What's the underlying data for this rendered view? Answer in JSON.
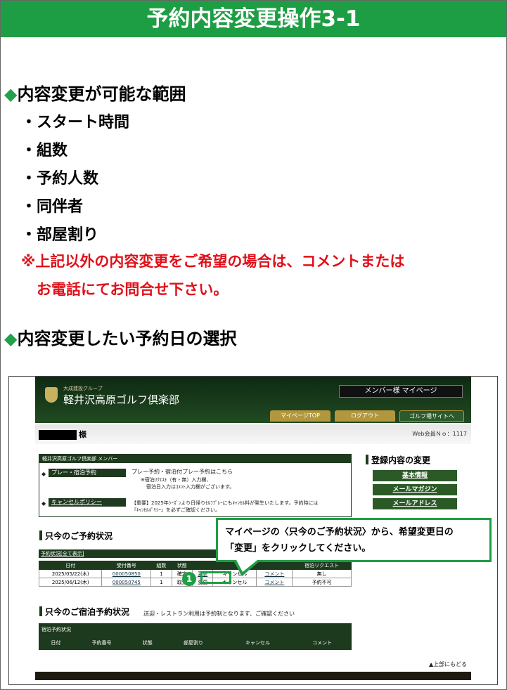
{
  "title": "予約内容変更操作3-1",
  "section1": {
    "heading": "内容変更が可能な範囲",
    "items": [
      "・スタート時間",
      "・組数",
      "・予約人数",
      "・同伴者",
      "・部屋割り"
    ]
  },
  "note": {
    "line1": "※上記以外の内容変更をご希望の場合は、コメントまたは",
    "line2": "お電話にてお問合せ下さい。"
  },
  "section2": {
    "heading": "内容変更したい予約日の選択"
  },
  "site": {
    "logo_sub": "大成建設グループ",
    "logo_main": "軽井沢高原ゴルフ倶楽部",
    "member_button": "メンバー様 マイページ",
    "nav": [
      "マイページTOP",
      "ログアウト",
      "ゴルフ場サイトへ"
    ],
    "user_suffix": "様",
    "web_member_no": "Web会員Ｎｏ：1117",
    "member_box_title": "軽井沢高原ゴルフ倶楽部 メンバー",
    "play_button": "プレー・宿泊予約",
    "play_text1": "プレー予約・宿泊付プレー予約はこちら",
    "play_text2": "※宿泊ﾘｸｴｽﾄ（有・無）入力欄、",
    "play_text3": "宿泊日入力はｺﾒﾝﾄ入力欄がございます。",
    "cancel_button": "キャンセルポリシー",
    "cancel_text1": "【重要】2025年ｼｰｽﾞﾝより日帰りｾﾙﾌﾌﾟﾚｰにもｷｬﾝｾﾙ料が発生いたします。予約時には",
    "cancel_text2": "『ｷｬﾝｾﾙﾎﾟﾘｼｰ』を必ずご確認ください。",
    "status_title": "只今のご予約状況",
    "status_box_label": "予約状況[全て表示]",
    "columns": [
      "日付",
      "受付番号",
      "組数",
      "状態",
      "",
      "",
      "",
      "宿泊リクエスト"
    ],
    "rows": [
      [
        "2025/05/22(木)",
        "000050850",
        "1",
        "確定",
        "変更",
        "キャンセル",
        "コメント",
        "無し"
      ],
      [
        "2025/06/12(木)",
        "000050745",
        "1",
        "取消",
        "変更",
        "キャンセル",
        "コメント",
        "予約不可"
      ]
    ],
    "stay_title": "只今のご宿泊予約状況",
    "stay_note": "送迎・レストラン利用は予約制となります、ご確認ください",
    "stay_box_label": "宿泊予約状況",
    "stay_columns": [
      "日付",
      "予約番号",
      "状態",
      "部屋割り",
      "キャンセル",
      "コメント"
    ],
    "side_title": "登録内容の変更",
    "side_buttons": [
      "基本情報",
      "メールマガジン",
      "メールアドレス"
    ],
    "back_to_top": "▲上部にもどる"
  },
  "callout": {
    "line1": "マイページの〈只今のご予約状況〉から、希望変更日の",
    "line2": "「変更」をクリックしてください。",
    "step": "1"
  },
  "colors": {
    "accent": "#1e9e44",
    "note": "#e0101a",
    "site_green": "#1e3a1e"
  }
}
